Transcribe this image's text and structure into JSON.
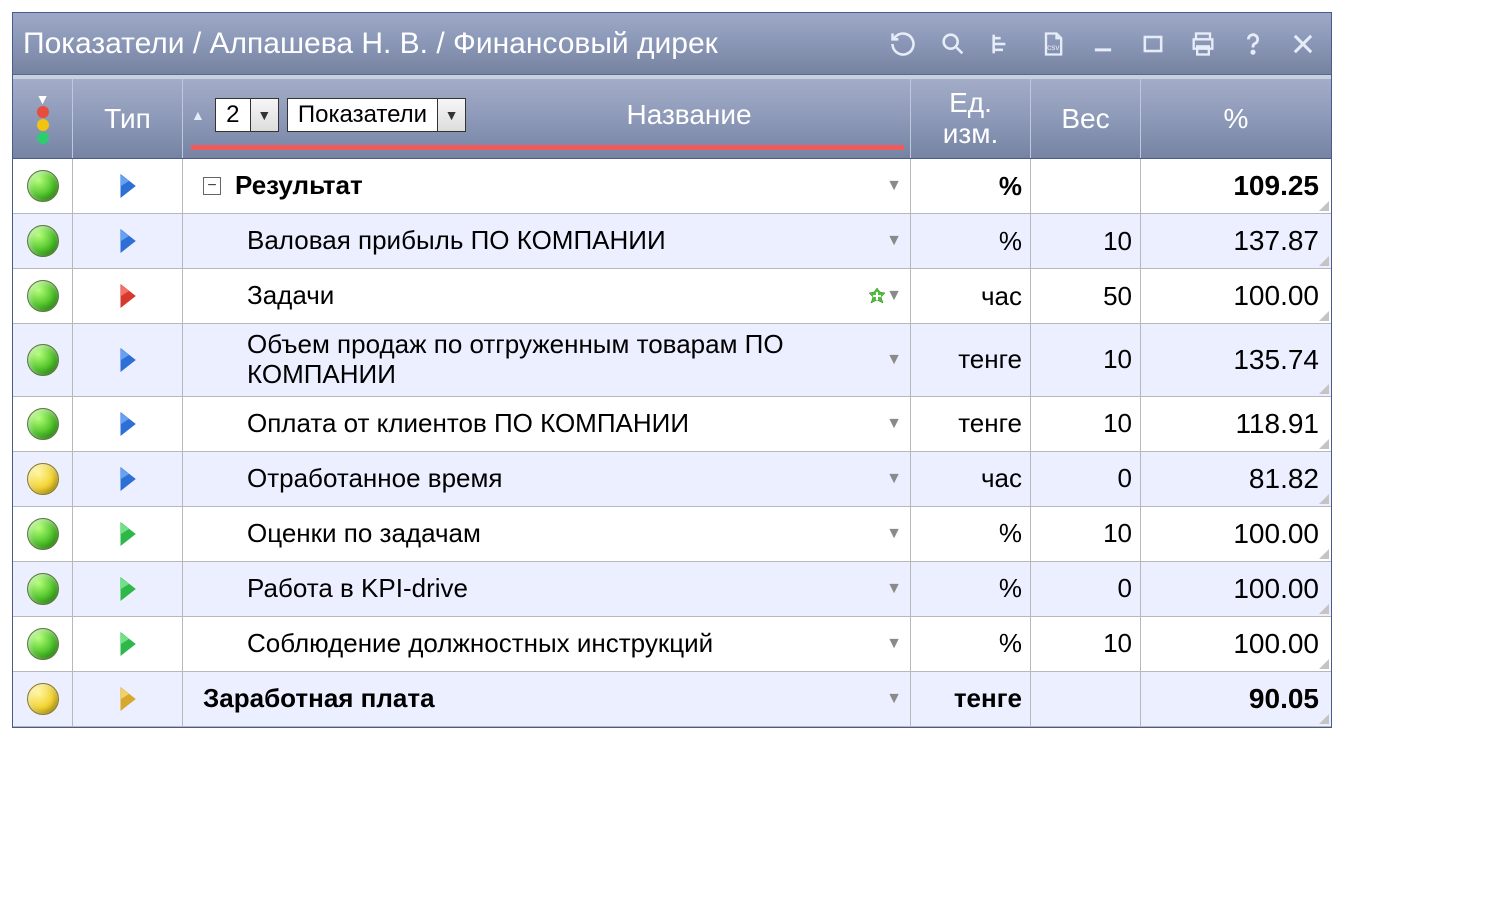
{
  "titlebar": {
    "title": "Показатели / Алпашева Н. В. / Финансовый дирек"
  },
  "header": {
    "type_label": "Тип",
    "level_value": "2",
    "combo_value": "Показатели",
    "name_label": "Название",
    "unit_label_1": "Ед.",
    "unit_label_2": "изм.",
    "weight_label": "Вес",
    "pct_label": "%"
  },
  "rows": [
    {
      "status": "green",
      "arrow": "blue",
      "indent": 1,
      "name": "Результат",
      "bold": true,
      "expand": true,
      "plus": false,
      "unit": "%",
      "weight": "",
      "pct": "109.25",
      "alt": false
    },
    {
      "status": "green",
      "arrow": "blue",
      "indent": 2,
      "name": "Валовая прибыль ПО КОМПАНИИ",
      "bold": false,
      "expand": false,
      "plus": false,
      "unit": "%",
      "weight": "10",
      "pct": "137.87",
      "alt": true
    },
    {
      "status": "green",
      "arrow": "red",
      "indent": 2,
      "name": "Задачи",
      "bold": false,
      "expand": false,
      "plus": true,
      "unit": "час",
      "weight": "50",
      "pct": "100.00",
      "alt": false
    },
    {
      "status": "green",
      "arrow": "blue",
      "indent": 2,
      "name": "Объем продаж по отгруженным товарам ПО КОМПАНИИ",
      "bold": false,
      "expand": false,
      "plus": false,
      "unit": "тенге",
      "weight": "10",
      "pct": "135.74",
      "alt": true
    },
    {
      "status": "green",
      "arrow": "blue",
      "indent": 2,
      "name": "Оплата от клиентов ПО КОМПАНИИ",
      "bold": false,
      "expand": false,
      "plus": false,
      "unit": "тенге",
      "weight": "10",
      "pct": "118.91",
      "alt": false
    },
    {
      "status": "yellow",
      "arrow": "blue",
      "indent": 2,
      "name": "Отработанное время",
      "bold": false,
      "expand": false,
      "plus": false,
      "unit": "час",
      "weight": "0",
      "pct": "81.82",
      "alt": true
    },
    {
      "status": "green",
      "arrow": "green",
      "indent": 2,
      "name": "Оценки по задачам",
      "bold": false,
      "expand": false,
      "plus": false,
      "unit": "%",
      "weight": "10",
      "pct": "100.00",
      "alt": false
    },
    {
      "status": "green",
      "arrow": "green",
      "indent": 2,
      "name": "Работа в KPI-drive",
      "bold": false,
      "expand": false,
      "plus": false,
      "unit": "%",
      "weight": "0",
      "pct": "100.00",
      "alt": true
    },
    {
      "status": "green",
      "arrow": "green",
      "indent": 2,
      "name": "Соблюдение должностных инструкций",
      "bold": false,
      "expand": false,
      "plus": false,
      "unit": "%",
      "weight": "10",
      "pct": "100.00",
      "alt": false
    },
    {
      "status": "yellow",
      "arrow": "yellow",
      "indent": 1,
      "name": "Заработная плата",
      "bold": true,
      "expand": false,
      "plus": false,
      "unit": "тенге",
      "weight": "",
      "pct": "90.05",
      "alt": true
    }
  ]
}
